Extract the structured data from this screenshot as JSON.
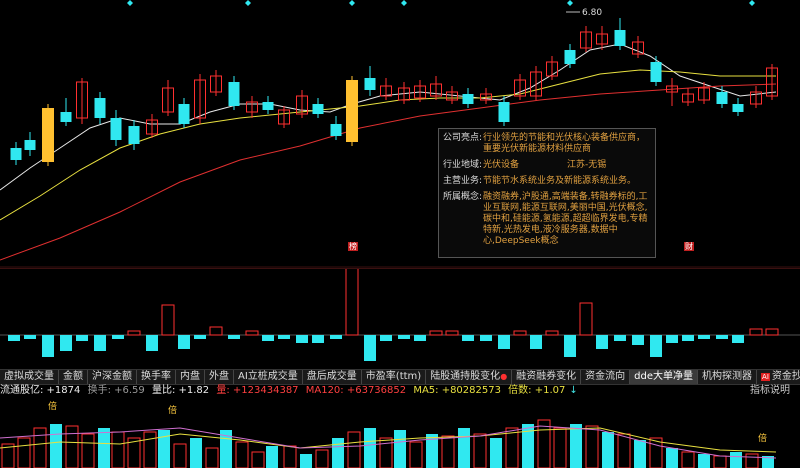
{
  "colors": {
    "up": "#ff3030",
    "down": "#30e8f0",
    "hl": "#ffc030",
    "ma_white": "#e8e8e8",
    "ma_yellow": "#e8e040",
    "ma_red": "#e03030",
    "tab_active": "#3a3a3a"
  },
  "main": {
    "high_label": "6.80",
    "markers": {
      "left": "榜",
      "right": "财"
    },
    "top_diamonds": 6
  },
  "tooltip": {
    "rows": [
      {
        "label": "公司亮点:",
        "value": "行业领先的节能和光伏核心装备供应商，重要光伏新能源材料供应商",
        "value2": ""
      },
      {
        "label": "行业地域:",
        "value": "光伏设备",
        "value2": "江苏-无锡"
      },
      {
        "label": "主营业务:",
        "value": "节能节水系统业务及新能源系统业务。",
        "value2": ""
      },
      {
        "label": "所属概念:",
        "value": "融资融券,沪股通,高端装备,转融券标的,工业互联网,能源互联网,美丽中国,光伏概念,碳中和,硅能源,氢能源,超超临界发电,专精特新,光热发电,液冷服务器,数据中心,DeepSeek概念",
        "value2": ""
      }
    ]
  },
  "tabs": [
    {
      "label": "虚拟成交量",
      "active": false
    },
    {
      "label": "金额",
      "active": false
    },
    {
      "label": "沪深金额",
      "active": false
    },
    {
      "label": "换手率",
      "active": false
    },
    {
      "label": "内盘",
      "active": false
    },
    {
      "label": "外盘",
      "active": false
    },
    {
      "label": "AI立桩成交量",
      "active": false
    },
    {
      "label": "盘后成交量",
      "active": false
    },
    {
      "label": "市盈率(ttm)",
      "active": false
    },
    {
      "label": "陆股通持股变化",
      "active": false,
      "dot": "●"
    },
    {
      "label": "融资融券变化",
      "active": false
    },
    {
      "label": "资金流向",
      "active": false
    },
    {
      "label": "dde大单净量",
      "active": true
    },
    {
      "label": "机构探测器",
      "active": false
    },
    {
      "label": "资金抄底",
      "active": false,
      "hot": "AI"
    }
  ],
  "infoline": {
    "float_shares": "流通股亿: +1874",
    "turnover": "换手: +6.59",
    "vol_ratio": "量比: +1.82",
    "volume": "量: +123434387",
    "ma120": "MA120: +63736852",
    "ma5": "MA5: +80282573",
    "multiple": "倍数: +1.07",
    "multiple_arrow": "↓",
    "help": "指标说明"
  },
  "indicator": {
    "bei_label": "倍"
  }
}
